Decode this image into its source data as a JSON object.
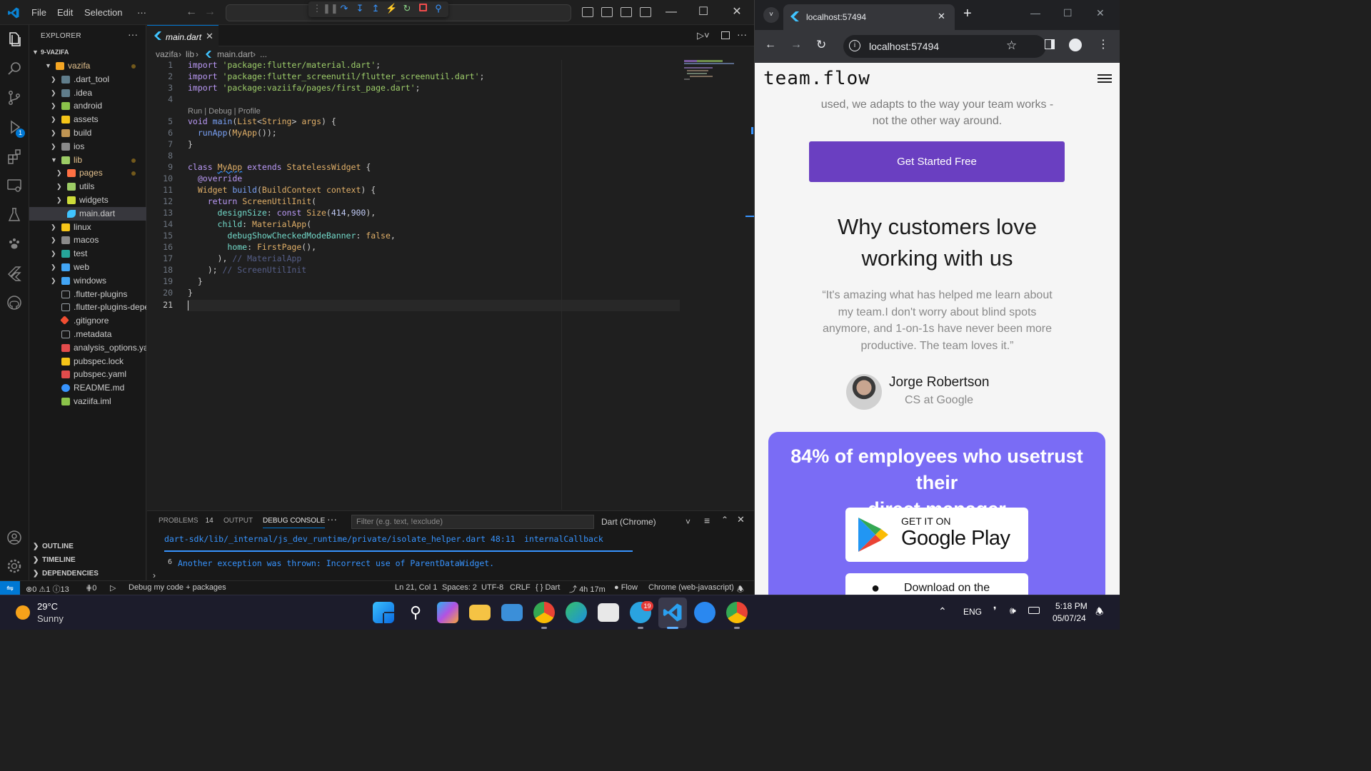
{
  "vscode": {
    "menu": [
      "File",
      "Edit",
      "Selection",
      "···"
    ],
    "explorer_title": "EXPLORER",
    "project": "9-VAZIFA",
    "tree": [
      {
        "label": "vazifa",
        "kind": "folder-open",
        "level": 0,
        "dot": true
      },
      {
        "label": ".dart_tool",
        "kind": "folder",
        "level": 1
      },
      {
        "label": ".idea",
        "kind": "folder",
        "level": 1
      },
      {
        "label": "android",
        "kind": "folder",
        "level": 1
      },
      {
        "label": "assets",
        "kind": "folder",
        "level": 1
      },
      {
        "label": "build",
        "kind": "folder",
        "level": 1
      },
      {
        "label": "ios",
        "kind": "folder",
        "level": 1
      },
      {
        "label": "lib",
        "kind": "folder-open",
        "level": 1,
        "dot": true
      },
      {
        "label": "pages",
        "kind": "folder",
        "level": 2,
        "dot": true
      },
      {
        "label": "utils",
        "kind": "folder",
        "level": 2
      },
      {
        "label": "widgets",
        "kind": "folder",
        "level": 2
      },
      {
        "label": "main.dart",
        "kind": "dart",
        "level": 2,
        "selected": true
      },
      {
        "label": "linux",
        "kind": "folder",
        "level": 1
      },
      {
        "label": "macos",
        "kind": "folder",
        "level": 1
      },
      {
        "label": "test",
        "kind": "folder",
        "level": 1
      },
      {
        "label": "web",
        "kind": "folder",
        "level": 1
      },
      {
        "label": "windows",
        "kind": "folder",
        "level": 1
      },
      {
        "label": ".flutter-plugins",
        "kind": "file",
        "level": 1
      },
      {
        "label": ".flutter-plugins-depe...",
        "kind": "file",
        "level": 1
      },
      {
        "label": ".gitignore",
        "kind": "git",
        "level": 1
      },
      {
        "label": ".metadata",
        "kind": "file",
        "level": 1
      },
      {
        "label": "analysis_options.yaml",
        "kind": "yaml-red",
        "level": 1
      },
      {
        "label": "pubspec.lock",
        "kind": "lock",
        "level": 1
      },
      {
        "label": "pubspec.yaml",
        "kind": "yaml-red",
        "level": 1
      },
      {
        "label": "README.md",
        "kind": "info",
        "level": 1
      },
      {
        "label": "vaziifa.iml",
        "kind": "iml",
        "level": 1
      }
    ],
    "sections": [
      "OUTLINE",
      "TIMELINE",
      "DEPENDENCIES"
    ],
    "tab_label": "main.dart",
    "breadcrumb": [
      "vazifa",
      "lib",
      "main.dart",
      "..."
    ],
    "codelens": "Run | Debug | Profile",
    "line_numbers": [
      "1",
      "2",
      "3",
      "4",
      "5",
      "6",
      "7",
      "8",
      "9",
      "10",
      "11",
      "12",
      "13",
      "14",
      "15",
      "16",
      "17",
      "18",
      "19",
      "20",
      "21"
    ],
    "panel_tabs": [
      "PROBLEMS",
      "OUTPUT",
      "DEBUG CONSOLE"
    ],
    "problems_count": "14",
    "filter_placeholder": "Filter (e.g. text, !exclude)",
    "debug_target": "Dart (Chrome)",
    "console": {
      "path": "dart-sdk/lib/_internal/js_dev_runtime/private/isolate_helper.dart 48:11",
      "callback": "internalCallback",
      "count": "6",
      "message": "Another exception was thrown: Incorrect use of ParentDataWidget."
    },
    "status": {
      "errors": "0",
      "warnings": "1",
      "info": "13",
      "ports": "0",
      "debug_mode": "Debug my code + packages",
      "position": "Ln 21, Col 1",
      "spaces": "Spaces: 2",
      "encoding": "UTF-8",
      "eol": "CRLF",
      "language": "Dart",
      "time": "4h 17m",
      "flow": "Flow",
      "device": "Chrome (web-javascript)"
    },
    "accent": "#0078d4"
  },
  "chrome": {
    "tab_title": "localhost:57494",
    "url": "localhost:57494",
    "site": {
      "logo": "team.flow",
      "hero_tail_1": "used, we adapts to the way your team works -",
      "hero_tail_2": "not the other way around.",
      "cta": "Get Started Free",
      "cta_color": "#6a3fc1",
      "section_title_1": "Why customers love",
      "section_title_2": "working with us",
      "quote_1": "“It's amazing what has helped me learn about",
      "quote_2": "my team.I don't worry about blind spots",
      "quote_3": "anymore, and 1-on-1s have never been more",
      "quote_4": "productive. The team loves it.”",
      "person_name": "Jorge Robertson",
      "person_role": "CS at Google",
      "stat_1": "84% of employees who usetrust their",
      "stat_2": "direct manager",
      "stat_color": "#7a6cf5",
      "gp_small": "GET IT ON",
      "gp_big": "Google Play",
      "app_store": "Download on the"
    }
  },
  "taskbar": {
    "weather_temp": "29°C",
    "weather_desc": "Sunny",
    "lang": "ENG",
    "time": "5:18 PM",
    "date": "05/07/24",
    "telegram_badge": "19"
  }
}
